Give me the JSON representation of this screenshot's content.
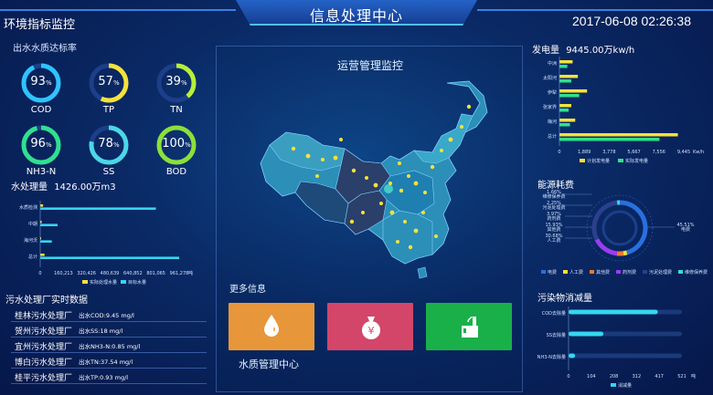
{
  "header": {
    "title": "信息处理中心",
    "datetime": "2017-06-08 02:26:38"
  },
  "env": {
    "title": "环境指标监控",
    "subtitle": "出水水质达标率",
    "gauges": [
      {
        "label": "COD",
        "value": "93",
        "unit": "%",
        "pct": 0.93,
        "color": "#2ec4ff"
      },
      {
        "label": "TP",
        "value": "57",
        "unit": "%",
        "pct": 0.57,
        "color": "#f5e23a"
      },
      {
        "label": "TN",
        "value": "39",
        "unit": "%",
        "pct": 0.39,
        "color": "#b6f03a"
      },
      {
        "label": "NH3-N",
        "value": "96",
        "unit": "%",
        "pct": 0.96,
        "color": "#2fe08f"
      },
      {
        "label": "SS",
        "value": "78",
        "unit": "%",
        "pct": 0.78,
        "color": "#4ad8e8"
      },
      {
        "label": "BOD",
        "value": "100",
        "unit": "%",
        "pct": 1.0,
        "color": "#8be03a"
      }
    ]
  },
  "water": {
    "title": "水处理量",
    "total": "1426.00万m3",
    "chart_data": {
      "type": "bar",
      "categories": [
        "水质检测",
        "中期",
        "海河沃",
        "总计"
      ],
      "series": [
        {
          "name": "实际处理水量",
          "values": [
            20000,
            10000,
            5000,
            30000
          ],
          "color": "#f5e23a"
        },
        {
          "name": "目标水量",
          "values": [
            800000,
            120000,
            80000,
            961278
          ],
          "color": "#35d6f0"
        }
      ],
      "xticks": [
        "0",
        "160,213",
        "320,426",
        "480,639",
        "640,852",
        "801,065",
        "961,278"
      ],
      "xunit": "吨",
      "xlim": [
        0,
        961278
      ]
    }
  },
  "plants": {
    "title": "污水处理厂实时数据",
    "rows": [
      {
        "name": "桂林污水处理厂",
        "value": "出水COD:9.45 mg/l"
      },
      {
        "name": "贺州污水处理厂",
        "value": "出水SS:18 mg/l"
      },
      {
        "name": "宜州污水处理厂",
        "value": "出水NH3-N:0.85 mg/l"
      },
      {
        "name": "博白污水处理厂",
        "value": "出水TN:37.54 mg/l"
      },
      {
        "name": "桂平污水处理厂",
        "value": "出水TP:0.93 mg/l"
      }
    ]
  },
  "center": {
    "map_title": "运营管理监控",
    "more_title": "更多信息",
    "caption": "水质管理中心",
    "cards": [
      {
        "name": "water-drop",
        "color": "#e8963a"
      },
      {
        "name": "money-bag",
        "color": "#d4456a"
      },
      {
        "name": "factory",
        "color": "#19b04a"
      }
    ]
  },
  "power": {
    "title": "发电量",
    "total": "9445.00万kw/h",
    "chart_data": {
      "type": "bar",
      "categories": [
        "中洲",
        "太阳河",
        "伊犁",
        "张家界",
        "梅河",
        "总计"
      ],
      "series": [
        {
          "name": "计划发电量",
          "values": [
            1000,
            1400,
            2100,
            900,
            1200,
            9000
          ],
          "color": "#f5e23a"
        },
        {
          "name": "实际发电量",
          "values": [
            600,
            900,
            1500,
            700,
            800,
            7600
          ],
          "color": "#2fe08f"
        }
      ],
      "xticks": [
        "0",
        "1,889",
        "3,778",
        "5,667",
        "7,556",
        "9,445"
      ],
      "xunit": "Kw/h",
      "xlim": [
        0,
        9445
      ]
    }
  },
  "energy": {
    "title": "能源耗费",
    "chart_data": {
      "type": "pie",
      "slices": [
        {
          "name": "电费",
          "value": 45.51,
          "color": "#2a6fe0"
        },
        {
          "name": "人工费",
          "value": 2.25,
          "color": "#f5e23a"
        },
        {
          "name": "其他费",
          "value": 3.97,
          "color": "#ee7a2a"
        },
        {
          "name": "药剂费",
          "value": 15.93,
          "color": "#9b3cf0"
        },
        {
          "name": "污泥处理费",
          "value": 30.68,
          "color": "#2a3f8f"
        },
        {
          "name": "维修保养费",
          "value": 1.66,
          "color": "#2fe0d0"
        }
      ],
      "callouts": [
        {
          "pct": "1.66%",
          "name": "维修保养费"
        },
        {
          "pct": "2.25%",
          "name": "污泥处理费"
        },
        {
          "pct": "3.97%",
          "name": "药剂费"
        },
        {
          "pct": "15.93%",
          "name": "其他费"
        },
        {
          "pct": "30.68%",
          "name": "人工费"
        },
        {
          "pct": "45.51%",
          "name": "电费"
        }
      ],
      "legend": [
        "电费",
        "人工费",
        "其他费",
        "药剂费",
        "污泥处理费",
        "维修保养费"
      ]
    }
  },
  "pollutant": {
    "title": "污染物消减量",
    "chart_data": {
      "type": "bar",
      "categories": [
        "COD去除量",
        "SS去除量",
        "NH3-N去除量"
      ],
      "values": [
        410,
        160,
        30
      ],
      "xticks": [
        "0",
        "104",
        "208",
        "312",
        "417",
        "521"
      ],
      "xunit": "吨",
      "xlim": [
        0,
        521
      ],
      "legend": "消减量"
    }
  }
}
